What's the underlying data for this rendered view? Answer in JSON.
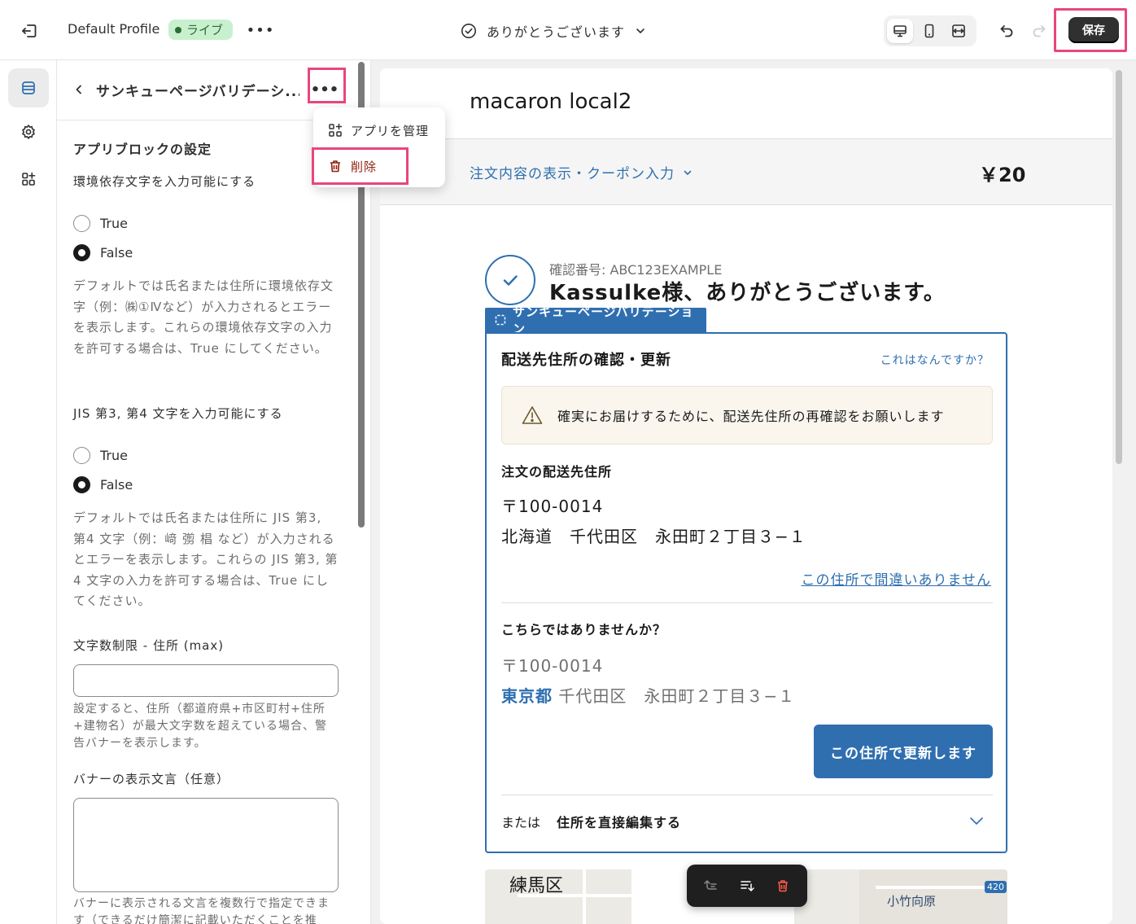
{
  "topbar": {
    "profile_name": "Default Profile",
    "live_label": "ライブ",
    "page_name": "ありがとうございます",
    "save_label": "保存"
  },
  "panel": {
    "title": "サンキューページバリデーシ...",
    "section_title": "アプリブロックの設定",
    "field1_label": "環境依存文字を入力可能にする",
    "field1_options": [
      "True",
      "False"
    ],
    "field1_selected": "False",
    "field1_help": "デフォルトでは氏名または住所に環境依存文字（例：㈱①Ⅳなど）が入力されるとエラーを表示します。これらの環境依存文字の入力を許可する場合は、True にしてください。",
    "field2_label": "JIS 第3, 第4 文字を入力可能にする",
    "field2_options": [
      "True",
      "False"
    ],
    "field2_selected": "False",
    "field2_help": "デフォルトでは氏名または住所に JIS 第3, 第4 文字（例：﨑 彅 椙 など）が入力されるとエラーを表示します。これらの JIS 第3, 第4 文字の入力を許可する場合は、True にしてください。",
    "field3_label": "文字数制限 - 住所 (max)",
    "field3_value": "",
    "field3_help": "設定すると、住所（都道府県+市区町村+住所+建物名）が最大文字数を超えている場合、警告バナーを表示します。",
    "field4_label": "バナーの表示文言（任意）",
    "field4_value": "",
    "field4_help": "バナーに表示される文言を複数行で指定できます（できるだけ簡潔に記載いただくことを推"
  },
  "menu": {
    "manage_label": "アプリを管理",
    "delete_label": "削除"
  },
  "preview": {
    "shop_name": "macaron local2",
    "order_toggle": "注文内容の表示・クーポン入力",
    "order_total": "￥20",
    "confirmation_number": "確認番号: ABC123EXAMPLE",
    "thanks_message": "Kassulke様、ありがとうございます。",
    "block_tab_label": "サンキューページバリデーション",
    "block_title": "配送先住所の確認・更新",
    "block_help_link": "これはなんですか？",
    "warning_text": "確実にお届けするために、配送先住所の再確認をお願いします",
    "order_address_heading": "注文の配送先住所",
    "order_postal": "〒100-0014",
    "order_address": "北海道　千代田区　永田町２丁目３−１",
    "confirm_link": "この住所で間違いありません",
    "suggest_heading": "こちらではありませんか？",
    "suggest_postal": "〒100-0014",
    "suggest_prefecture": "東京都",
    "suggest_address_rest": "千代田区　永田町２丁目３−１",
    "update_button": "この住所で更新します",
    "or_label": "または",
    "edit_label": "住所を直接編集する",
    "map_label_1": "練馬区",
    "map_label_2": "小竹向原",
    "map_label_3": "420"
  },
  "colors": {
    "accent": "#2f6fb0",
    "highlight": "#e8477a",
    "live_bg": "#c8f0cf",
    "delete": "#8e1f0b"
  },
  "icons": {
    "exit": "exit-icon",
    "check": "circle-check-icon",
    "desktop": "desktop-icon",
    "mobile": "mobile-icon",
    "fullwidth": "fullwidth-icon",
    "undo": "undo-icon",
    "redo": "redo-icon",
    "sections": "sections-icon",
    "settings": "gear-icon",
    "apps": "apps-icon",
    "trash": "trash-icon",
    "warning": "warning-icon"
  }
}
